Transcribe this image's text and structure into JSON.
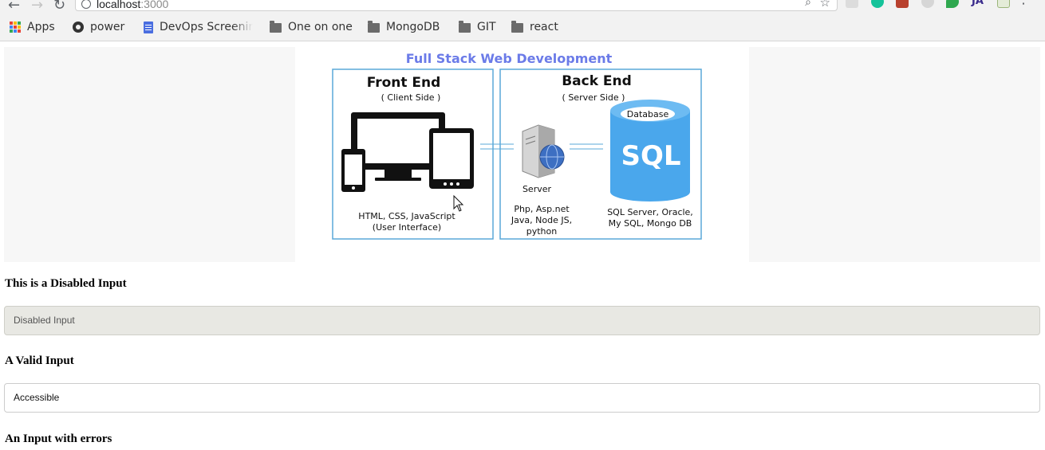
{
  "browser": {
    "url_host": "localhost",
    "url_port": ":3000",
    "icons": {
      "back": "back-arrow-icon",
      "forward": "forward-arrow-icon",
      "reload": "reload-icon",
      "zoom": "magnifier-icon",
      "star": "star-icon",
      "menu": "more-vert-icon"
    }
  },
  "bookmarks": [
    {
      "label": "Apps",
      "icon": "apps-grid-icon"
    },
    {
      "label": "power",
      "icon": "github-icon"
    },
    {
      "label": "DevOps Screenir",
      "icon": "doc-icon"
    },
    {
      "label": "One on one",
      "icon": "folder-icon"
    },
    {
      "label": "MongoDB",
      "icon": "folder-icon"
    },
    {
      "label": "GIT",
      "icon": "folder-icon"
    },
    {
      "label": "react",
      "icon": "folder-icon"
    }
  ],
  "diagram": {
    "title": "Full Stack Web Development",
    "front": {
      "heading": "Front End",
      "sub": "( Client Side )",
      "caption1": "HTML, CSS, JavaScript",
      "caption2": "(User Interface)"
    },
    "back": {
      "heading": "Back End",
      "sub": "( Server Side )",
      "server_label": "Server",
      "server_lang1": "Php, Asp.net",
      "server_lang2": "Java, Node JS,",
      "server_lang3": "python",
      "db_label": "Database",
      "db_text": "SQL",
      "db_caption1": "SQL Server, Oracle,",
      "db_caption2": "My SQL, Mongo DB"
    },
    "colors": {
      "title": "#6b7be8",
      "frame": "#5aa8d8",
      "db": "#4aa7ec"
    }
  },
  "form": {
    "disabled_heading": "This is a Disabled Input",
    "disabled_value": "Disabled Input",
    "valid_heading": "A Valid Input",
    "valid_value": "Accessible",
    "error_heading": "An Input with errors"
  }
}
